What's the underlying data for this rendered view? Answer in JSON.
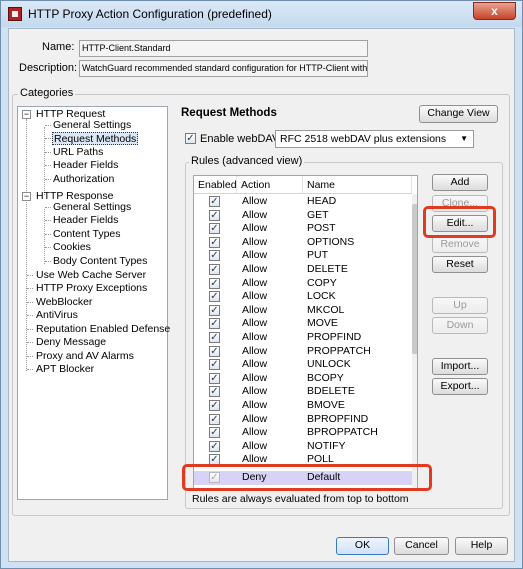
{
  "window": {
    "title": "HTTP Proxy Action Configuration (predefined)",
    "close": "x"
  },
  "name_label": "Name:",
  "name_value": "HTTP-Client.Standard",
  "description_label": "Description:",
  "description_value": "WatchGuard recommended standard configuration for HTTP-Client with logging en",
  "categories_title": "Categories",
  "tree": {
    "http_request": "HTTP Request",
    "req_general": "General Settings",
    "req_methods": "Request Methods",
    "req_url": "URL Paths",
    "req_header": "Header Fields",
    "req_auth": "Authorization",
    "http_response": "HTTP Response",
    "resp_general": "General Settings",
    "resp_header": "Header Fields",
    "resp_content": "Content Types",
    "resp_cookies": "Cookies",
    "resp_body": "Body Content Types",
    "web_cache": "Use Web Cache Server",
    "exceptions": "HTTP Proxy Exceptions",
    "webblocker": "WebBlocker",
    "antivirus": "AntiVirus",
    "reputation": "Reputation Enabled Defense",
    "deny_message": "Deny Message",
    "alarms": "Proxy and AV Alarms",
    "apt": "APT Blocker",
    "expander_collapse": "−"
  },
  "section_title": "Request Methods",
  "change_view": "Change View",
  "enable_webdav": {
    "label": "Enable webDAV",
    "check": "✓"
  },
  "webdav_select": {
    "value": "RFC 2518 webDAV plus extensions",
    "arrow": "▼"
  },
  "rules_title": "Rules (advanced view)",
  "columns": {
    "enabled": "Enabled",
    "action": "Action",
    "name": "Name"
  },
  "rules": [
    {
      "check": "✓",
      "action": "Allow",
      "name": "HEAD"
    },
    {
      "check": "✓",
      "action": "Allow",
      "name": "GET"
    },
    {
      "check": "✓",
      "action": "Allow",
      "name": "POST"
    },
    {
      "check": "✓",
      "action": "Allow",
      "name": "OPTIONS"
    },
    {
      "check": "✓",
      "action": "Allow",
      "name": "PUT"
    },
    {
      "check": "✓",
      "action": "Allow",
      "name": "DELETE"
    },
    {
      "check": "✓",
      "action": "Allow",
      "name": "COPY"
    },
    {
      "check": "✓",
      "action": "Allow",
      "name": "LOCK"
    },
    {
      "check": "✓",
      "action": "Allow",
      "name": "MKCOL"
    },
    {
      "check": "✓",
      "action": "Allow",
      "name": "MOVE"
    },
    {
      "check": "✓",
      "action": "Allow",
      "name": "PROPFIND"
    },
    {
      "check": "✓",
      "action": "Allow",
      "name": "PROPPATCH"
    },
    {
      "check": "✓",
      "action": "Allow",
      "name": "UNLOCK"
    },
    {
      "check": "✓",
      "action": "Allow",
      "name": "BCOPY"
    },
    {
      "check": "✓",
      "action": "Allow",
      "name": "BDELETE"
    },
    {
      "check": "✓",
      "action": "Allow",
      "name": "BMOVE"
    },
    {
      "check": "✓",
      "action": "Allow",
      "name": "BPROPFIND"
    },
    {
      "check": "✓",
      "action": "Allow",
      "name": "BPROPPATCH"
    },
    {
      "check": "✓",
      "action": "Allow",
      "name": "NOTIFY"
    },
    {
      "check": "✓",
      "action": "Allow",
      "name": "POLL"
    }
  ],
  "default_rule": {
    "check": "✓",
    "action": "Deny",
    "name": "Default"
  },
  "rules_note": "Rules are always evaluated from top to bottom",
  "side_buttons": {
    "add": "Add",
    "clone": "Clone...",
    "edit": "Edit...",
    "remove": "Remove",
    "reset": "Reset",
    "up": "Up",
    "down": "Down",
    "import": "Import...",
    "export": "Export..."
  },
  "footer": {
    "ok": "OK",
    "cancel": "Cancel",
    "help": "Help"
  },
  "colors": {
    "highlight": "#e03a1f",
    "default_row": "#d9d2f7",
    "titlebar": "#c4d9ee"
  }
}
